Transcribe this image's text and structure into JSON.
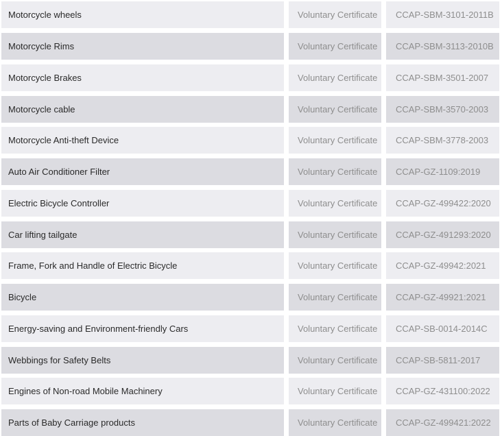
{
  "table": {
    "rows": [
      {
        "product": "Motorcycle wheels",
        "type": "Voluntary Certificate",
        "standard": "CCAP-SBM-3101-2011B"
      },
      {
        "product": "Motorcycle Rims",
        "type": "Voluntary Certificate",
        "standard": "CCAP-SBM-3113-2010B"
      },
      {
        "product": "Motorcycle Brakes",
        "type": "Voluntary Certificate",
        "standard": "CCAP-SBM-3501-2007"
      },
      {
        "product": "Motorcycle cable",
        "type": "Voluntary Certificate",
        "standard": "CCAP-SBM-3570-2003"
      },
      {
        "product": "Motorcycle Anti-theft Device",
        "type": "Voluntary Certificate",
        "standard": "CCAP-SBM-3778-2003"
      },
      {
        "product": "Auto Air Conditioner Filter",
        "type": "Voluntary Certificate",
        "standard": "CCAP-GZ-1109:2019"
      },
      {
        "product": "Electric Bicycle Controller",
        "type": "Voluntary Certificate",
        "standard": "CCAP-GZ-499422:2020"
      },
      {
        "product": "Car lifting tailgate",
        "type": "Voluntary Certificate",
        "standard": "CCAP-GZ-491293:2020"
      },
      {
        "product": "Frame, Fork and Handle of Electric Bicycle",
        "type": "Voluntary Certificate",
        "standard": "CCAP-GZ-49942:2021"
      },
      {
        "product": "Bicycle",
        "type": "Voluntary Certificate",
        "standard": "CCAP-GZ-49921:2021"
      },
      {
        "product": "Energy-saving and Environment-friendly Cars",
        "type": "Voluntary Certificate",
        "standard": "CCAP-SB-0014-2014C"
      },
      {
        "product": "Webbings for Safety Belts",
        "type": "Voluntary Certificate",
        "standard": "CCAP-SB-5811-2017"
      },
      {
        "product": "Engines of Non-road Mobile Machinery",
        "type": "Voluntary Certificate",
        "standard": "CCAP-GZ-431100:2022"
      },
      {
        "product": "Parts of Baby Carriage products",
        "type": "Voluntary Certificate",
        "standard": "CCAP-GZ-499421:2022"
      }
    ]
  }
}
